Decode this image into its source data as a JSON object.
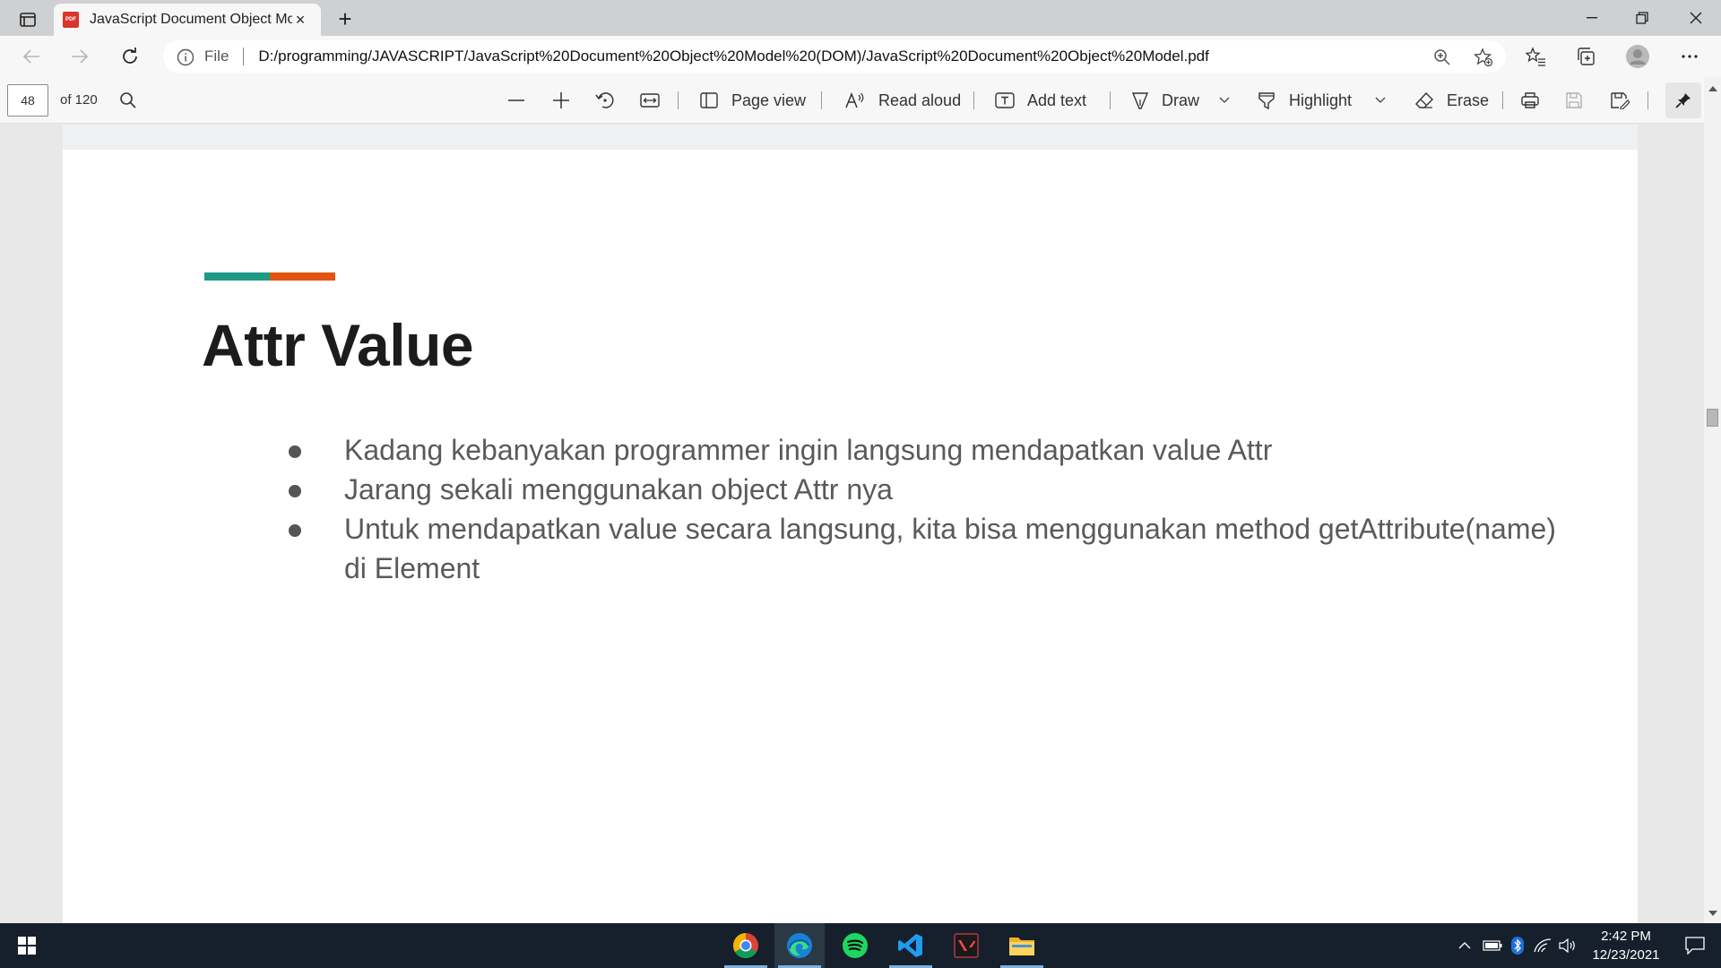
{
  "browser": {
    "tab_title": "JavaScript Document Object Model.pdf",
    "pdf_badge": "PDF",
    "new_tab_symbol": "+",
    "close_symbol": "×",
    "address": {
      "scheme_label": "File",
      "url": "D:/programming/JAVASCRIPT/JavaScript%20Document%20Object%20Model%20(DOM)/JavaScript%20Document%20Object%20Model.pdf"
    }
  },
  "pdf_toolbar": {
    "page_number": "48",
    "page_count": "of 120",
    "page_view": "Page view",
    "read_aloud": "Read aloud",
    "add_text": "Add text",
    "draw": "Draw",
    "highlight": "Highlight",
    "erase": "Erase"
  },
  "slide": {
    "title": "Attr Value",
    "accent_colors": [
      "#1e9b86",
      "#e2540f"
    ],
    "bullets": [
      "Kadang kebanyakan programmer ingin langsung mendapatkan value Attr",
      "Jarang sekali menggunakan object Attr nya",
      "Untuk mendapatkan value secara langsung, kita bisa menggunakan method getAttribute(name) di Element"
    ]
  },
  "taskbar": {
    "apps": [
      "chrome-icon",
      "edge-icon",
      "spotify-icon",
      "vscode-icon",
      "valorant-icon",
      "file-explorer-icon"
    ],
    "time": "2:42 PM",
    "date": "12/23/2021"
  }
}
